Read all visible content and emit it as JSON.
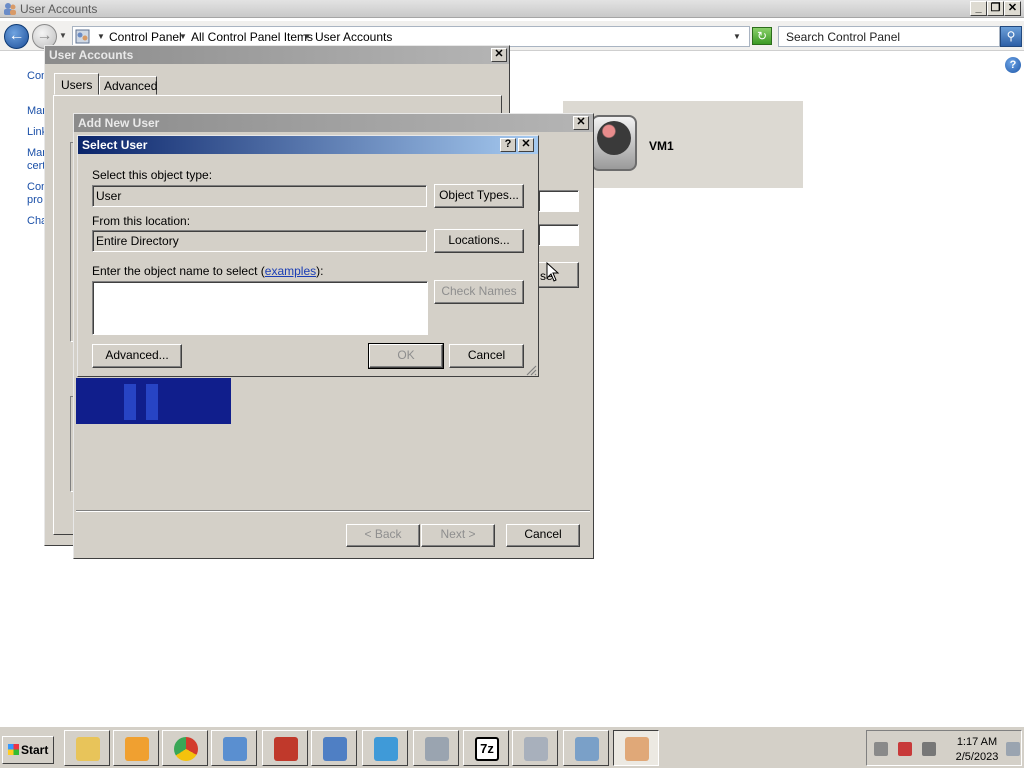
{
  "window": {
    "title": "User Accounts",
    "minimize": "_",
    "restore": "❐",
    "close": "✕"
  },
  "addressbar": {
    "crumbs": [
      "Control Panel",
      "All Control Panel Items",
      "User Accounts"
    ],
    "search_placeholder": "Search Control Panel"
  },
  "help_glyph": "?",
  "left_links": [
    "Con",
    "Man",
    "Link",
    "Man",
    "cert",
    "Con",
    "pro",
    "Cha"
  ],
  "vm_panel": {
    "label": "VM1"
  },
  "user_accounts_dialog": {
    "title": "User Accounts",
    "close": "✕",
    "tabs": [
      "Users",
      "Advanced"
    ],
    "fragments": [
      "U",
      "se"
    ]
  },
  "add_new_user_dialog": {
    "title": "Add New User",
    "close": "✕",
    "back_label": "< Back",
    "next_label": "Next >",
    "cancel_label": "Cancel"
  },
  "select_user_dialog": {
    "title": "Select User",
    "help": "?",
    "close": "✕",
    "object_type_label": "Select this object type:",
    "object_type_value": "User",
    "object_types_button": "Object Types...",
    "location_label": "From this location:",
    "location_value": "Entire Directory",
    "locations_button": "Locations...",
    "object_name_label_prefix": "Enter the object name to select (",
    "examples_link": "examples",
    "object_name_label_suffix": "):",
    "object_name_value": "",
    "check_names_button": "Check Names",
    "advanced_button": "Advanced...",
    "ok_button": "OK",
    "cancel_button": "Cancel"
  },
  "taskbar": {
    "start_label": "Start",
    "apps": [
      {
        "icon": "explorer-icon",
        "color": "#e8c45a"
      },
      {
        "icon": "media-player-icon",
        "color": "#f0a030"
      },
      {
        "icon": "chrome-icon",
        "color": "#d33b2c"
      },
      {
        "icon": "server-manager-icon",
        "color": "#5a8fd0"
      },
      {
        "icon": "toolbox-icon",
        "color": "#c0392b"
      },
      {
        "icon": "network-transfer-icon",
        "color": "#4f7fc4"
      },
      {
        "icon": "network-settings-icon",
        "color": "#3f9ad8"
      },
      {
        "icon": "shield-app-icon",
        "color": "#9aa4b0"
      },
      {
        "icon": "7zip-icon",
        "color": "#000000"
      },
      {
        "icon": "windows-app-icon",
        "color": "#a8b0bc"
      },
      {
        "icon": "remote-desktop-icon",
        "color": "#7aa0c8"
      },
      {
        "icon": "user-accounts-icon",
        "color": "#e0a878"
      }
    ],
    "clock_time": "1:17 AM",
    "clock_date": "2/5/2023"
  }
}
